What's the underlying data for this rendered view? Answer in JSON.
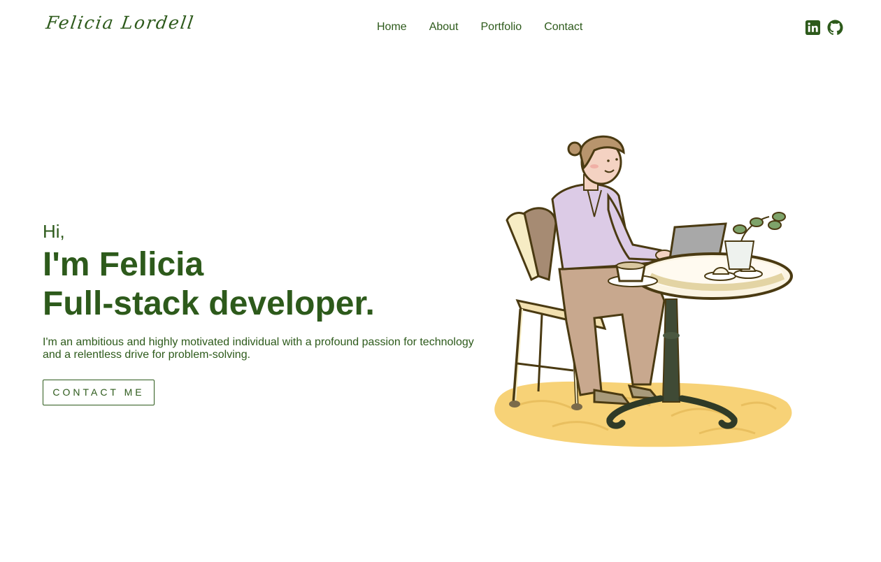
{
  "header": {
    "logo_text": "Felicia Lordell",
    "nav": [
      {
        "label": "Home"
      },
      {
        "label": "About"
      },
      {
        "label": "Portfolio"
      },
      {
        "label": "Contact"
      }
    ],
    "socials": [
      {
        "icon": "linkedin-icon"
      },
      {
        "icon": "github-icon"
      }
    ]
  },
  "hero": {
    "greeting": "Hi,",
    "headline_line1": "I'm Felicia",
    "headline_line2": "Full-stack developer.",
    "intro": "I'm an ambitious and highly motivated individual with a profound passion for technology and a relentless drive for problem-solving.",
    "cta_label": "CONTACT ME"
  },
  "illustration": {
    "subject": "woman-working-on-laptop-at-cafe-table"
  },
  "colors": {
    "accent": "#2d5a1b",
    "background": "#ffffff",
    "floor": "#f7d277",
    "shirt": "#dccbe6",
    "pants": "#c8a88e"
  }
}
